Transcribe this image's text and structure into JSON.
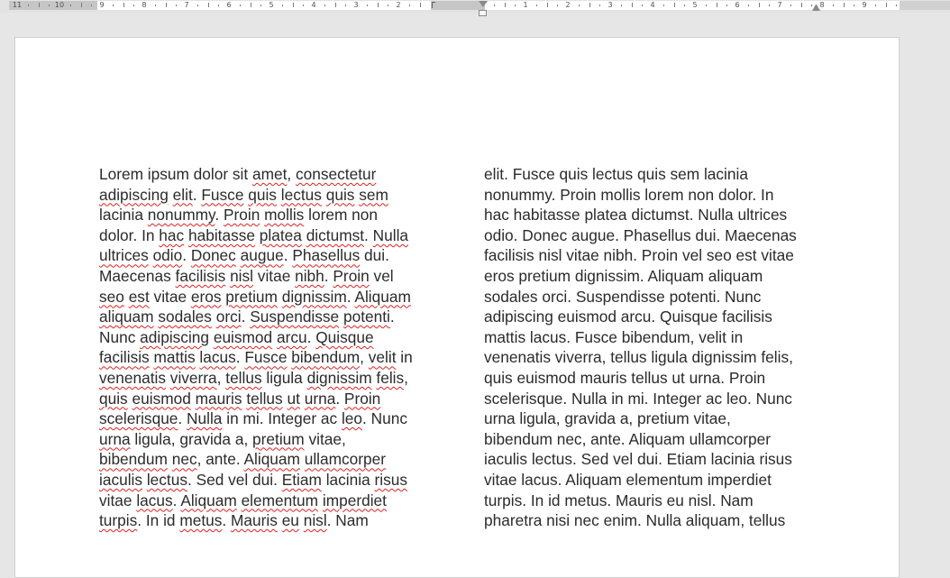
{
  "ruler": {
    "numbers_left": [
      "11",
      "10",
      "9",
      "8",
      "7",
      "6",
      "5",
      "4",
      "3",
      "2"
    ],
    "numbers_right": [
      "1",
      "2",
      "3",
      "4",
      "5",
      "6",
      "7",
      "8",
      "9"
    ]
  },
  "document": {
    "column_one_lines": [
      [
        {
          "t": "Lorem ipsum dolor sit "
        },
        {
          "t": "amet",
          "s": 1
        },
        {
          "t": ", "
        },
        {
          "t": "consectetur",
          "s": 1
        }
      ],
      [
        {
          "t": "adipiscing",
          "s": 1
        },
        {
          "t": " "
        },
        {
          "t": "elit",
          "s": 1
        },
        {
          "t": ". "
        },
        {
          "t": "Fusce",
          "s": 1
        },
        {
          "t": " "
        },
        {
          "t": "quis",
          "s": 1
        },
        {
          "t": " "
        },
        {
          "t": "lectus",
          "s": 1
        },
        {
          "t": " "
        },
        {
          "t": "quis",
          "s": 1
        },
        {
          "t": " "
        },
        {
          "t": "sem",
          "s": 1
        }
      ],
      [
        {
          "t": "lacinia "
        },
        {
          "t": "nonummy",
          "s": 1
        },
        {
          "t": ". "
        },
        {
          "t": "Proin",
          "s": 1
        },
        {
          "t": " "
        },
        {
          "t": "mollis",
          "s": 1
        },
        {
          "t": " lorem non"
        }
      ],
      [
        {
          "t": "dolor. In "
        },
        {
          "t": "hac",
          "s": 1
        },
        {
          "t": " "
        },
        {
          "t": "habitasse",
          "s": 1
        },
        {
          "t": " "
        },
        {
          "t": "platea",
          "s": 1
        },
        {
          "t": " "
        },
        {
          "t": "dictumst",
          "s": 1
        },
        {
          "t": ". "
        },
        {
          "t": "Nulla",
          "s": 1
        }
      ],
      [
        {
          "t": "ultrices",
          "s": 1
        },
        {
          "t": " "
        },
        {
          "t": "odio",
          "s": 1
        },
        {
          "t": ". "
        },
        {
          "t": "Donec",
          "s": 1
        },
        {
          "t": " "
        },
        {
          "t": "augue",
          "s": 1
        },
        {
          "t": ". "
        },
        {
          "t": "Phasellus",
          "s": 1
        },
        {
          "t": " dui."
        }
      ],
      [
        {
          "t": "Maecenas "
        },
        {
          "t": "facilisis",
          "s": 1
        },
        {
          "t": " "
        },
        {
          "t": "nisl",
          "s": 1
        },
        {
          "t": " vitae "
        },
        {
          "t": "nibh",
          "s": 1
        },
        {
          "t": ". "
        },
        {
          "t": "Proin",
          "s": 1
        },
        {
          "t": " vel"
        }
      ],
      [
        {
          "t": "seo",
          "s": 1
        },
        {
          "t": " "
        },
        {
          "t": "est",
          "s": 1
        },
        {
          "t": " vitae "
        },
        {
          "t": "eros",
          "s": 1
        },
        {
          "t": " "
        },
        {
          "t": "pretium",
          "s": 1
        },
        {
          "t": " "
        },
        {
          "t": "dignissim",
          "s": 1
        },
        {
          "t": ". "
        },
        {
          "t": "Aliquam",
          "s": 1
        }
      ],
      [
        {
          "t": "aliquam",
          "s": 1
        },
        {
          "t": " "
        },
        {
          "t": "sodales",
          "s": 1
        },
        {
          "t": " "
        },
        {
          "t": "orci",
          "s": 1
        },
        {
          "t": ". "
        },
        {
          "t": "Suspendisse",
          "s": 1
        },
        {
          "t": " "
        },
        {
          "t": "potenti",
          "s": 1
        },
        {
          "t": "."
        }
      ],
      [
        {
          "t": "Nunc "
        },
        {
          "t": "adipiscing",
          "s": 1
        },
        {
          "t": " "
        },
        {
          "t": "euismod",
          "s": 1
        },
        {
          "t": " "
        },
        {
          "t": "arcu",
          "s": 1
        },
        {
          "t": ". "
        },
        {
          "t": "Quisque",
          "s": 1
        }
      ],
      [
        {
          "t": "facilisis",
          "s": 1
        },
        {
          "t": " "
        },
        {
          "t": "mattis",
          "s": 1
        },
        {
          "t": " "
        },
        {
          "t": "lacus",
          "s": 1
        },
        {
          "t": ". "
        },
        {
          "t": "Fusce",
          "s": 1
        },
        {
          "t": " "
        },
        {
          "t": "bibendum",
          "s": 1
        },
        {
          "t": ", "
        },
        {
          "t": "velit",
          "s": 1
        },
        {
          "t": " in"
        }
      ],
      [
        {
          "t": "venenatis",
          "s": 1
        },
        {
          "t": " "
        },
        {
          "t": "viverra",
          "s": 1
        },
        {
          "t": ", "
        },
        {
          "t": "tellus",
          "s": 1
        },
        {
          "t": " ligula "
        },
        {
          "t": "dignissim",
          "s": 1
        },
        {
          "t": " "
        },
        {
          "t": "felis",
          "s": 1
        },
        {
          "t": ","
        }
      ],
      [
        {
          "t": "quis",
          "s": 1
        },
        {
          "t": " "
        },
        {
          "t": "euismod",
          "s": 1
        },
        {
          "t": " "
        },
        {
          "t": "mauris",
          "s": 1
        },
        {
          "t": " "
        },
        {
          "t": "tellus",
          "s": 1
        },
        {
          "t": " "
        },
        {
          "t": "ut",
          "s": 1
        },
        {
          "t": " "
        },
        {
          "t": "urna",
          "s": 1
        },
        {
          "t": ". "
        },
        {
          "t": "Proin",
          "s": 1
        }
      ],
      [
        {
          "t": "scelerisque",
          "s": 1
        },
        {
          "t": ". "
        },
        {
          "t": "Nulla",
          "s": 1
        },
        {
          "t": " in mi. Integer ac "
        },
        {
          "t": "leo",
          "s": 1
        },
        {
          "t": ". Nunc"
        }
      ],
      [
        {
          "t": "urna",
          "s": 1
        },
        {
          "t": " ligula, gravida a, "
        },
        {
          "t": "pretium",
          "s": 1
        },
        {
          "t": " vitae,"
        }
      ],
      [
        {
          "t": "bibendum",
          "s": 1
        },
        {
          "t": " "
        },
        {
          "t": "nec",
          "s": 1
        },
        {
          "t": ", ante. "
        },
        {
          "t": "Aliquam",
          "s": 1
        },
        {
          "t": " "
        },
        {
          "t": "ullamcorper",
          "s": 1
        }
      ],
      [
        {
          "t": "iaculis",
          "s": 1
        },
        {
          "t": " "
        },
        {
          "t": "lectus",
          "s": 1
        },
        {
          "t": ". Sed vel dui. "
        },
        {
          "t": "Etiam",
          "s": 1
        },
        {
          "t": " lacinia "
        },
        {
          "t": "risus",
          "s": 1
        }
      ],
      [
        {
          "t": "vitae "
        },
        {
          "t": "lacus",
          "s": 1
        },
        {
          "t": ". "
        },
        {
          "t": "Aliquam",
          "s": 1
        },
        {
          "t": " "
        },
        {
          "t": "elementum",
          "s": 1
        },
        {
          "t": " "
        },
        {
          "t": "imperdiet",
          "s": 1
        }
      ],
      [
        {
          "t": "turpis",
          "s": 1
        },
        {
          "t": ". In id "
        },
        {
          "t": "metus",
          "s": 1
        },
        {
          "t": ". "
        },
        {
          "t": "Mauris",
          "s": 1
        },
        {
          "t": " "
        },
        {
          "t": "eu",
          "s": 1
        },
        {
          "t": " "
        },
        {
          "t": "nisl",
          "s": 1
        },
        {
          "t": ". Nam"
        }
      ]
    ],
    "column_two_lines": [
      "elit. Fusce quis lectus quis sem lacinia",
      "nonummy. Proin mollis lorem non dolor. In",
      "hac habitasse platea dictumst. Nulla ultrices",
      "odio. Donec augue. Phasellus dui. Maecenas",
      "facilisis nisl vitae nibh. Proin vel seo est vitae",
      "eros pretium dignissim. Aliquam aliquam",
      "sodales orci. Suspendisse potenti. Nunc",
      "adipiscing euismod arcu. Quisque facilisis",
      "mattis lacus. Fusce bibendum, velit in",
      "venenatis viverra, tellus ligula dignissim felis,",
      "quis euismod mauris tellus ut urna. Proin",
      "scelerisque. Nulla in mi. Integer ac leo. Nunc",
      "urna ligula, gravida a, pretium vitae,",
      "bibendum nec, ante. Aliquam ullamcorper",
      "iaculis lectus. Sed vel dui. Etiam lacinia risus",
      "vitae lacus. Aliquam elementum imperdiet",
      "turpis. In id metus. Mauris eu nisl. Nam",
      "pharetra nisi nec enim. Nulla aliquam, tellus"
    ]
  },
  "colors": {
    "spelling_underline": "#e02020",
    "text": "#2b2b2b",
    "canvas": "#e6e6e6",
    "page": "#ffffff"
  }
}
